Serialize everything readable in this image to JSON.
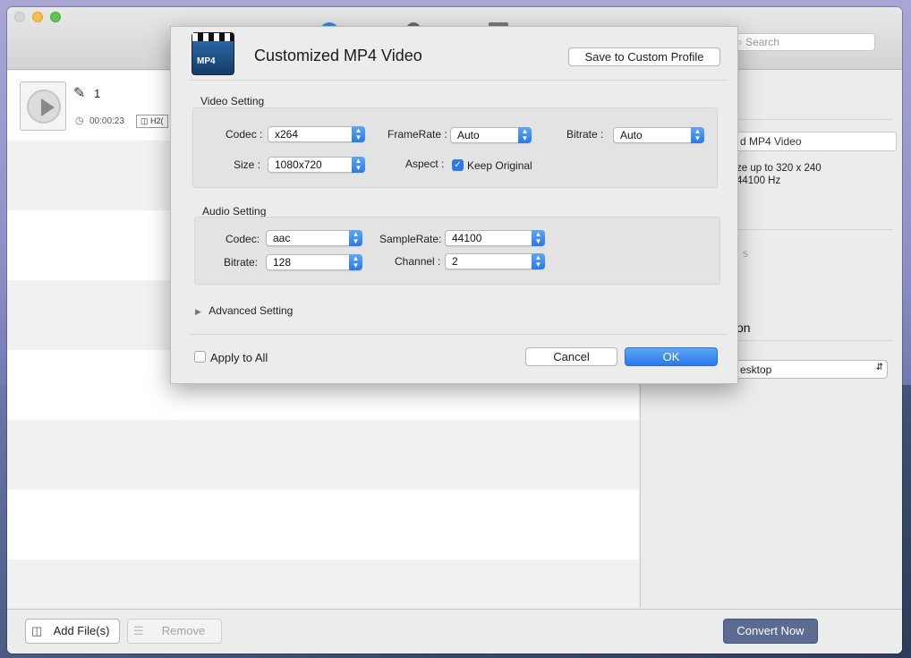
{
  "dialog": {
    "title": "Customized MP4 Video",
    "icon_text": "MP4",
    "save_profile_label": "Save to Custom Profile",
    "video": {
      "section_label": "Video Setting",
      "codec_label": "Codec :",
      "codec_value": "x264",
      "framerate_label": "FrameRate :",
      "framerate_value": "Auto",
      "bitrate_label": "Bitrate :",
      "bitrate_value": "Auto",
      "size_label": "Size :",
      "size_value": "1080x720",
      "aspect_label": "Aspect :",
      "aspect_checkbox_label": "Keep Original",
      "aspect_checked": true
    },
    "audio": {
      "section_label": "Audio Setting",
      "codec_label": "Codec:",
      "codec_value": "aac",
      "samplerate_label": "SampleRate:",
      "samplerate_value": "44100",
      "bitrate_label": "Bitrate:",
      "bitrate_value": "128",
      "channel_label": "Channel :",
      "channel_value": "2"
    },
    "advanced_label": "Advanced Setting",
    "apply_all_label": "Apply to All",
    "apply_all_checked": false,
    "cancel_label": "Cancel",
    "ok_label": "OK"
  },
  "toolbar": {
    "search_placeholder": "Search"
  },
  "file_item": {
    "name": "1",
    "duration": "00:00:23",
    "codec_badge": "H2("
  },
  "right_panel": {
    "profile_partial": "d MP4 Video",
    "details_line1": "ze up to 320 x 240",
    "details_line2": "44100 Hz",
    "faded_partial": "s",
    "heading_partial": "on",
    "destination_partial": "esktop"
  },
  "bottom": {
    "add_files_label": "Add File(s)",
    "remove_label": "Remove",
    "convert_label": "Convert Now"
  },
  "colors": {
    "accent": "#2a79e6",
    "convert_button": "#5b6b92"
  }
}
